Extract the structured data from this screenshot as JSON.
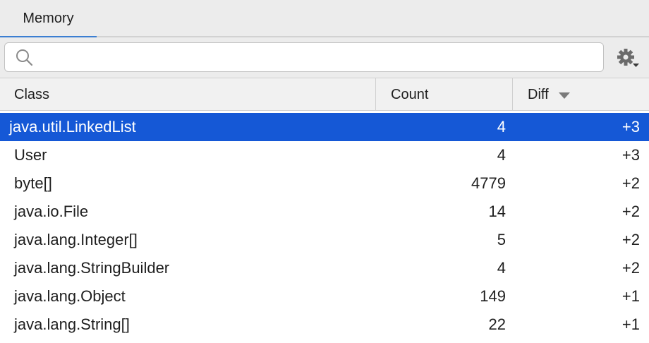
{
  "tabs": [
    {
      "label": "Memory"
    }
  ],
  "search": {
    "placeholder": "",
    "value": ""
  },
  "columns": {
    "class": "Class",
    "count": "Count",
    "diff": "Diff"
  },
  "rows": [
    {
      "class": "java.util.LinkedList",
      "count": "4",
      "diff": "+3",
      "selected": true
    },
    {
      "class": "User",
      "count": "4",
      "diff": "+3"
    },
    {
      "class": "byte[]",
      "count": "4779",
      "diff": "+2"
    },
    {
      "class": "java.io.File",
      "count": "14",
      "diff": "+2"
    },
    {
      "class": "java.lang.Integer[]",
      "count": "5",
      "diff": "+2"
    },
    {
      "class": "java.lang.StringBuilder",
      "count": "4",
      "diff": "+2"
    },
    {
      "class": "java.lang.Object",
      "count": "149",
      "diff": "+1"
    },
    {
      "class": "java.lang.String[]",
      "count": "22",
      "diff": "+1"
    }
  ],
  "icons": {
    "search": "search-icon",
    "settings": "gear-icon",
    "sort": "sort-descending-icon"
  },
  "colors": {
    "selection": "#1558d6",
    "tab_accent": "#3c7fd2"
  }
}
